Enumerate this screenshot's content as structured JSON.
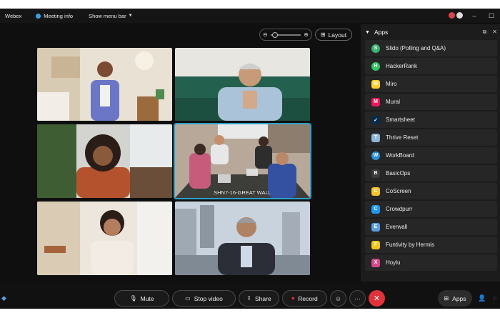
{
  "titlebar": {
    "app_name": "Webex",
    "meeting_info": "Meeting info",
    "show_menu_bar": "Show menu bar",
    "minimize": "–",
    "maximize": "☐"
  },
  "view": {
    "layout_label": "Layout",
    "zoom_out": "⊖",
    "zoom_in": "⊕"
  },
  "tiles": [
    {
      "caption": ""
    },
    {
      "caption": ""
    },
    {
      "caption": ""
    },
    {
      "caption": "SHN7-16-GREAT WALL"
    },
    {
      "caption": ""
    },
    {
      "caption": ""
    }
  ],
  "apps_panel": {
    "title": "Apps",
    "apps": [
      {
        "name": "Slido (Polling and Q&A)",
        "icon": "S",
        "color": "#3cb371"
      },
      {
        "name": "HackerRank",
        "icon": "H",
        "color": "#2ec866"
      },
      {
        "name": "Miro",
        "icon": "M",
        "color": "#ffd02f"
      },
      {
        "name": "Mural",
        "icon": "M",
        "color": "#e8185c"
      },
      {
        "name": "Smartsheet",
        "icon": "✓",
        "color": "#0b2a4a"
      },
      {
        "name": "Thrive Reset",
        "icon": "T",
        "color": "#8fb6d9"
      },
      {
        "name": "WorkBoard",
        "icon": "W",
        "color": "#2a8fd6"
      },
      {
        "name": "BasicOps",
        "icon": "B",
        "color": "#3a3a3a"
      },
      {
        "name": "CoScreen",
        "icon": "C",
        "color": "#f2c230"
      },
      {
        "name": "Crowdpurr",
        "icon": "C",
        "color": "#2196f3"
      },
      {
        "name": "Everwall",
        "icon": "E",
        "color": "#5aa0e0"
      },
      {
        "name": "Funtivity by Hermis",
        "icon": "F",
        "color": "#f5c518"
      },
      {
        "name": "Hoylu",
        "icon": "X",
        "color": "#d64a8a"
      }
    ]
  },
  "toolbar": {
    "mute": "Mute",
    "stop_video": "Stop video",
    "share": "Share",
    "record": "Record",
    "more": "···",
    "end": "✕",
    "apps": "Apps"
  },
  "colors": {
    "accent": "#2ea1c9",
    "end_call": "#e0323a",
    "record_red": "#e0323a"
  }
}
